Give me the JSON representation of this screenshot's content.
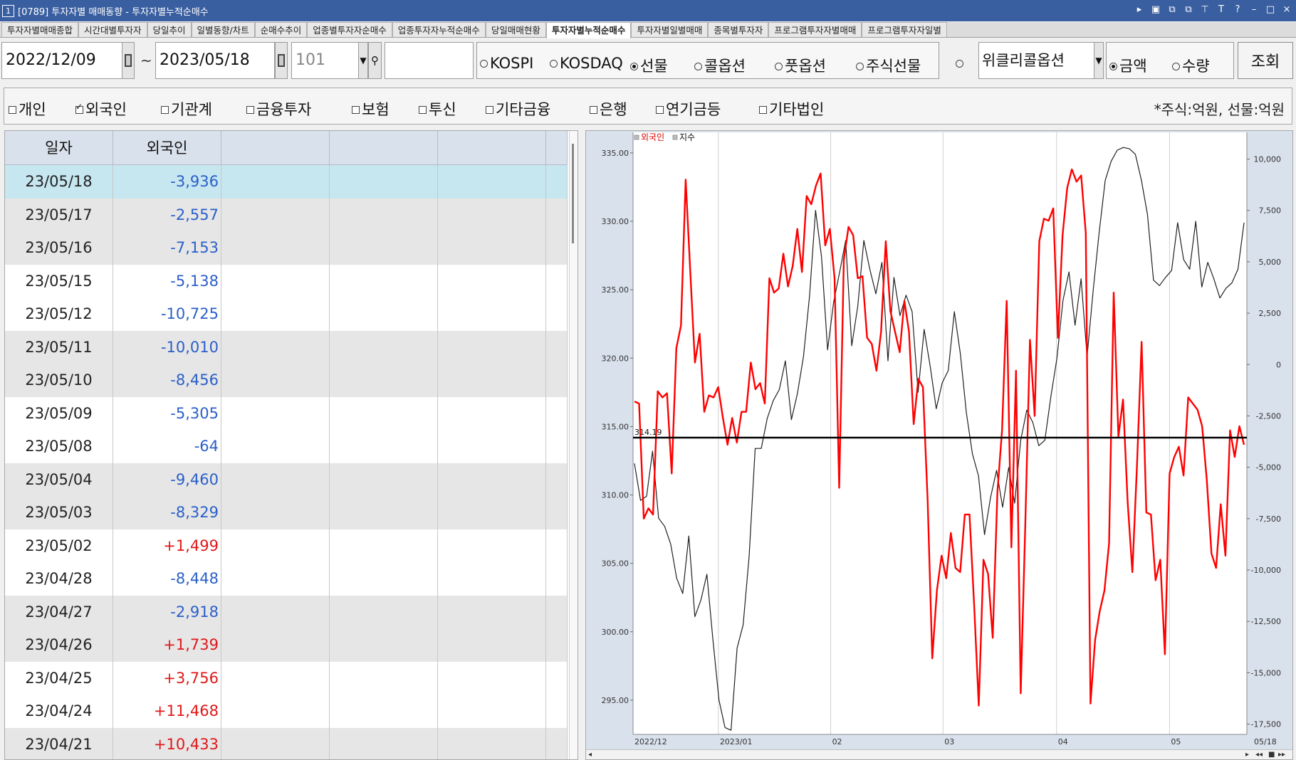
{
  "window": {
    "number": "1",
    "title": "[0789] 투자자별 매매동향 - 투자자별누적순매수",
    "controls": [
      "▸",
      "▣",
      "⧉",
      "⧉",
      "⊤",
      "T",
      "?",
      "–",
      "□",
      "×"
    ]
  },
  "tabs": [
    "투자자별매매종합",
    "시간대별투자자",
    "당일추이",
    "일별동향/차트",
    "순매수추이",
    "업종별투자자순매수",
    "업종투자자누적순매수",
    "당일매매현황",
    "투자자별누적순매수",
    "투자자별일별매매",
    "종목별투자자",
    "프로그램투자자별매매",
    "프로그램투자자일별"
  ],
  "active_tab": 8,
  "toolbar": {
    "start_date": "2022/12/09",
    "tilde": "~",
    "end_date": "2023/05/18",
    "code": "101",
    "market_options": [
      "KOSPI",
      "KOSDAQ",
      "선물",
      "콜옵션",
      "풋옵션",
      "주식선물",
      ""
    ],
    "market_selected": 2,
    "option_select": "위클리콜옵션",
    "unit_options": [
      "금액",
      "수량"
    ],
    "unit_selected": 0,
    "query_label": "조회"
  },
  "investors": {
    "items": [
      "개인",
      "외국인",
      "기관계",
      "금융투자",
      "보험",
      "투신",
      "기타금융",
      "은행",
      "연기금등",
      "기타법인"
    ],
    "checked": [
      false,
      true,
      false,
      false,
      false,
      false,
      false,
      false,
      false,
      false
    ],
    "unit_note": "*주식:억원, 선물:억원"
  },
  "table": {
    "headers": [
      "일자",
      "외국인"
    ],
    "rows": [
      {
        "date": "23/05/18",
        "value": "-3,936"
      },
      {
        "date": "23/05/17",
        "value": "-2,557"
      },
      {
        "date": "23/05/16",
        "value": "-7,153"
      },
      {
        "date": "23/05/15",
        "value": "-5,138"
      },
      {
        "date": "23/05/12",
        "value": "-10,725"
      },
      {
        "date": "23/05/11",
        "value": "-10,010"
      },
      {
        "date": "23/05/10",
        "value": "-8,456"
      },
      {
        "date": "23/05/09",
        "value": "-5,305"
      },
      {
        "date": "23/05/08",
        "value": "-64"
      },
      {
        "date": "23/05/04",
        "value": "-9,460"
      },
      {
        "date": "23/05/03",
        "value": "-8,329"
      },
      {
        "date": "23/05/02",
        "value": "+1,499"
      },
      {
        "date": "23/04/28",
        "value": "-8,448"
      },
      {
        "date": "23/04/27",
        "value": "-2,918"
      },
      {
        "date": "23/04/26",
        "value": "+1,739"
      },
      {
        "date": "23/04/25",
        "value": "+3,756"
      },
      {
        "date": "23/04/24",
        "value": "+11,468"
      },
      {
        "date": "23/04/21",
        "value": "+10,433"
      }
    ],
    "selected_row": 0
  },
  "chart_data": {
    "type": "line",
    "legend": [
      "외국인",
      "지수"
    ],
    "colors": {
      "외국인": "#ff0000",
      "지수": "#202020",
      "baseline": "#000000"
    },
    "x_ticks": [
      "2022/12",
      "2023/01",
      "02",
      "03",
      "04",
      "05",
      "05/18"
    ],
    "left_axis": {
      "ticks": [
        "335.00",
        "330.00",
        "325.00",
        "320.00",
        "315.00",
        "310.00",
        "305.00",
        "300.00",
        "295.00"
      ],
      "range": [
        292.5,
        336.5
      ]
    },
    "right_axis": {
      "ticks": [
        "10,000",
        "7,500",
        "5,000",
        "2,500",
        "0",
        "-2,500",
        "-5,000",
        "-7,500",
        "-10,000",
        "-12,500",
        "-15,000",
        "-17,500"
      ],
      "range": [
        -18000,
        11300
      ]
    },
    "baseline_label": "314.19",
    "baseline_value": 314.19,
    "series": [
      {
        "name": "지수",
        "axis": "left",
        "values": [
          312.3,
          309.6,
          309.9,
          313.2,
          308.3,
          307.7,
          306.4,
          303.9,
          302.8,
          307.0,
          301.1,
          302.3,
          304.2,
          299.4,
          295.0,
          293.0,
          292.8,
          298.8,
          300.5,
          305.5,
          313.4,
          313.4,
          315.6,
          316.9,
          317.7,
          319.8,
          315.5,
          317.4,
          320.1,
          324.5,
          330.8,
          327.4,
          320.6,
          324.1,
          326.3,
          328.6,
          320.9,
          323.8,
          328.6,
          326.5,
          324.7,
          327.0,
          319.8,
          325.9,
          323.1,
          324.6,
          323.4,
          317.5,
          322.1,
          319.4,
          316.3,
          318.2,
          319.1,
          323.4,
          320.3,
          316.0,
          313.0,
          311.4,
          307.1,
          309.8,
          311.8,
          309.1,
          312.0,
          309.4,
          314.0,
          316.2,
          315.3,
          313.6,
          314.0,
          317.2,
          320.0,
          324.2,
          326.3,
          322.4,
          325.8,
          320.1,
          324.9,
          329.2,
          333.0,
          334.4,
          335.2,
          335.4,
          335.3,
          334.9,
          333.0,
          330.5,
          325.7,
          325.3,
          325.9,
          326.4,
          329.9,
          327.2,
          326.5,
          330.0,
          325.2,
          327.0,
          325.8,
          324.4,
          325.1,
          325.5,
          326.5,
          329.9
        ]
      },
      {
        "name": "외국인",
        "axis": "right",
        "values": [
          -1800,
          -1900,
          -7500,
          -7000,
          -7300,
          -1300,
          -1600,
          -1400,
          -5300,
          800,
          1900,
          9000,
          4500,
          100,
          1500,
          -2300,
          -1500,
          -1600,
          -1100,
          -2600,
          -3900,
          -2600,
          -3800,
          -2300,
          -2300,
          100,
          -1200,
          -900,
          -1900,
          4200,
          3500,
          3700,
          5400,
          3800,
          4800,
          6600,
          4500,
          8200,
          7800,
          8700,
          9300,
          5800,
          6600,
          4200,
          -6000,
          5100,
          6700,
          6300,
          4200,
          4300,
          1300,
          1000,
          -300,
          1600,
          6000,
          2600,
          1600,
          600,
          3100,
          1600,
          -2900,
          -700,
          -1100,
          -6600,
          -14300,
          -11000,
          -9300,
          -10400,
          -8200,
          -9900,
          -10100,
          -7300,
          -7300,
          -11700,
          -16600,
          -9500,
          -10200,
          -13300,
          -6200,
          -3200,
          3100,
          -8900,
          -300,
          -16000,
          -7700,
          1200,
          -2500,
          6000,
          7100,
          7000,
          7600,
          1300,
          6300,
          8600,
          9500,
          8900,
          9200,
          6400,
          -16500,
          -13400,
          -12000,
          -11000,
          -8700,
          3500,
          -3500,
          -1700,
          -6700,
          -10100,
          -4900,
          1100,
          -7200,
          -7300,
          -10500,
          -9500,
          -14100,
          -5300,
          -4500,
          -4000,
          -5400,
          -1600,
          -1900,
          -2200,
          -3000,
          -5600,
          -9200,
          -9900,
          -6800,
          -9300,
          -3200,
          -4500,
          -3000,
          -3900
        ]
      }
    ]
  }
}
